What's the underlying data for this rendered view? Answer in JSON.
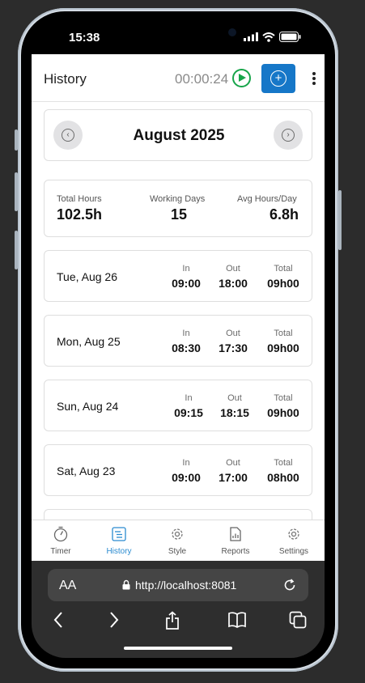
{
  "status_bar": {
    "time": "15:38"
  },
  "header": {
    "title": "History",
    "timer": "00:00:24",
    "play_icon": "play-circle-icon",
    "add_icon": "plus-circle-icon",
    "menu_icon": "more-vertical-icon",
    "accent_color": "#1677c8",
    "play_color": "#17a54a"
  },
  "month_nav": {
    "title": "August 2025",
    "prev_icon": "chevron-left-icon",
    "next_icon": "chevron-right-icon"
  },
  "summary": {
    "total_hours_label": "Total Hours",
    "total_hours_value": "102.5h",
    "working_days_label": "Working Days",
    "working_days_value": "15",
    "avg_label": "Avg Hours/Day",
    "avg_value": "6.8h"
  },
  "columns": {
    "in": "In",
    "out": "Out",
    "total": "Total"
  },
  "days": [
    {
      "date": "Tue, Aug 26",
      "in": "09:00",
      "out": "18:00",
      "total": "09h00"
    },
    {
      "date": "Mon, Aug 25",
      "in": "08:30",
      "out": "17:30",
      "total": "09h00"
    },
    {
      "date": "Sun, Aug 24",
      "in": "09:15",
      "out": "18:15",
      "total": "09h00"
    },
    {
      "date": "Sat, Aug 23",
      "in": "09:00",
      "out": "17:00",
      "total": "08h00"
    }
  ],
  "tabs": [
    {
      "label": "Timer",
      "icon": "stopwatch-icon"
    },
    {
      "label": "History",
      "icon": "history-list-icon",
      "active": true
    },
    {
      "label": "Style",
      "icon": "gear-icon"
    },
    {
      "label": "Reports",
      "icon": "report-chart-icon"
    },
    {
      "label": "Settings",
      "icon": "gear-icon"
    }
  ],
  "browser": {
    "aa_label": "AA",
    "url": "http://localhost:8081"
  }
}
